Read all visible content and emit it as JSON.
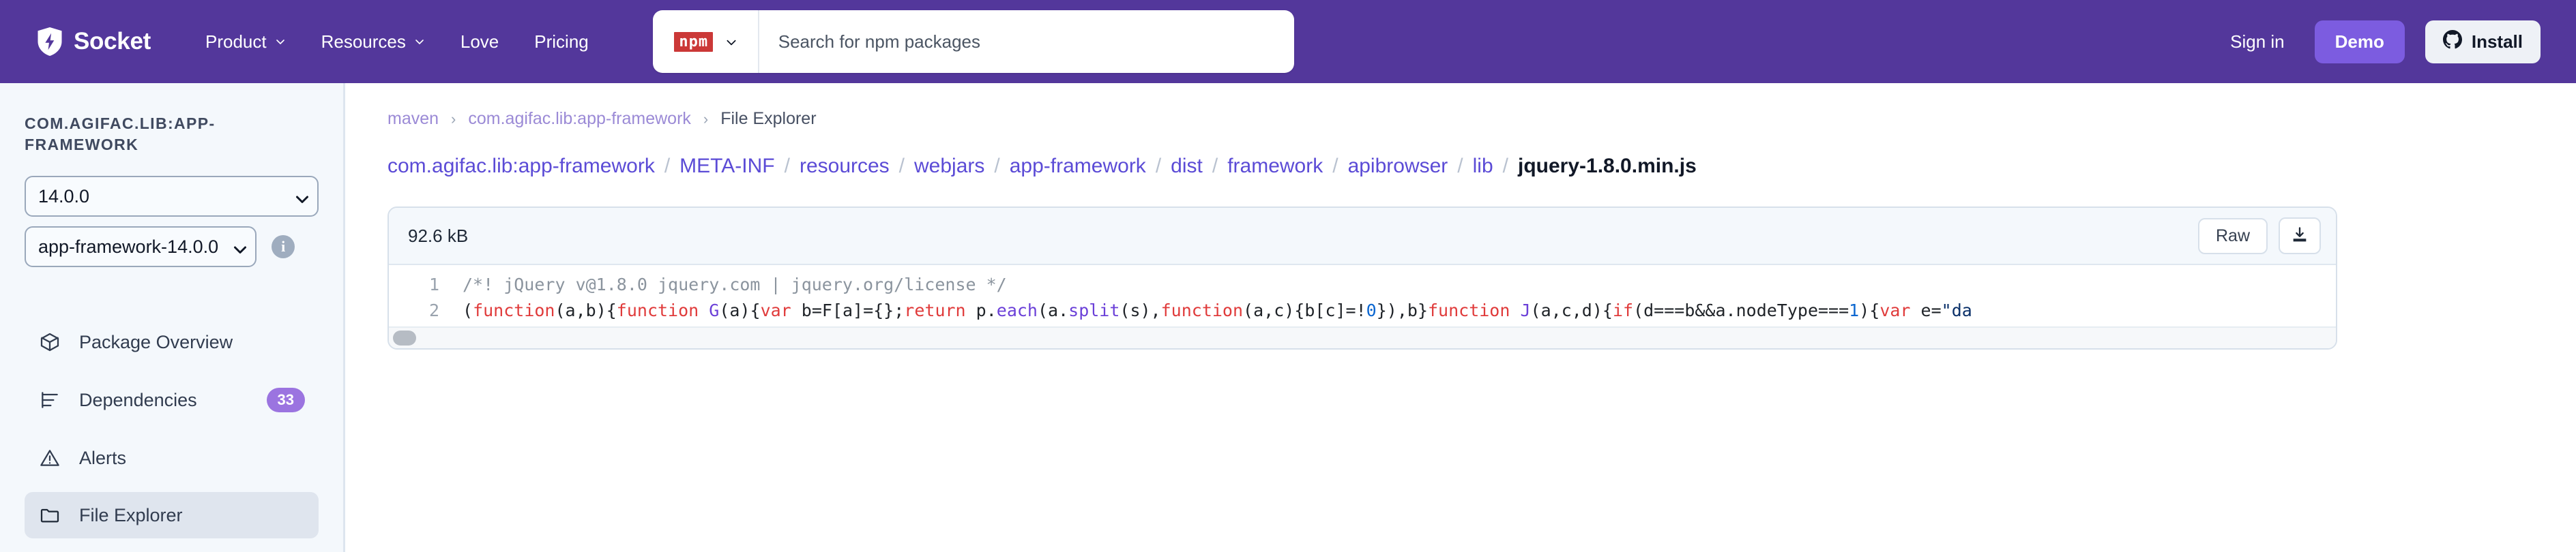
{
  "header": {
    "brand": "Socket",
    "nav": [
      {
        "label": "Product",
        "has_caret": true
      },
      {
        "label": "Resources",
        "has_caret": true
      },
      {
        "label": "Love",
        "has_caret": false
      },
      {
        "label": "Pricing",
        "has_caret": false
      }
    ],
    "search": {
      "ecosystem": "npm",
      "placeholder": "Search for npm packages",
      "value": ""
    },
    "sign_in": "Sign in",
    "demo": "Demo",
    "install": "Install",
    "bg_color": "#53379b",
    "demo_color": "#7c5ce0"
  },
  "sidebar": {
    "package_title": "com.agifac.lib:app-framework",
    "version_select": "14.0.0",
    "artifact_select": "app-framework-14.0.0",
    "items": [
      {
        "label": "Package Overview",
        "icon": "package-icon",
        "badge": null,
        "active": false
      },
      {
        "label": "Dependencies",
        "icon": "dependencies-icon",
        "badge": "33",
        "active": false
      },
      {
        "label": "Alerts",
        "icon": "alert-triangle-icon",
        "badge": null,
        "active": false
      },
      {
        "label": "File Explorer",
        "icon": "folder-icon",
        "badge": null,
        "active": true
      }
    ],
    "badge_color": "#9b74e0"
  },
  "breadcrumb": {
    "items": [
      "maven",
      "com.agifac.lib:app-framework",
      "File Explorer"
    ],
    "separator": "›"
  },
  "file_path": {
    "segments": [
      "com.agifac.lib:app-framework",
      "META-INF",
      "resources",
      "webjars",
      "app-framework",
      "dist",
      "framework",
      "apibrowser",
      "lib"
    ],
    "separator": "/",
    "file_name": "jquery-1.8.0.min.js"
  },
  "file_card": {
    "size": "92.6 kB",
    "raw_label": "Raw",
    "download_icon": "download-icon",
    "lines": [
      {
        "number": "1",
        "tokens": [
          {
            "t": "/*! jQuery v@1.8.0 jquery.com | jquery.org/license */",
            "c": "c-comment"
          }
        ]
      },
      {
        "number": "2",
        "tokens": [
          {
            "t": "(",
            "c": "c-plain"
          },
          {
            "t": "function",
            "c": "c-kw"
          },
          {
            "t": "(a,b){",
            "c": "c-plain"
          },
          {
            "t": "function",
            "c": "c-kw"
          },
          {
            "t": " ",
            "c": "c-plain"
          },
          {
            "t": "G",
            "c": "c-fn"
          },
          {
            "t": "(a){",
            "c": "c-plain"
          },
          {
            "t": "var",
            "c": "c-kw"
          },
          {
            "t": " b=F[a]={};",
            "c": "c-plain"
          },
          {
            "t": "return",
            "c": "c-kw"
          },
          {
            "t": " p.",
            "c": "c-plain"
          },
          {
            "t": "each",
            "c": "c-fn"
          },
          {
            "t": "(a.",
            "c": "c-plain"
          },
          {
            "t": "split",
            "c": "c-fn"
          },
          {
            "t": "(s),",
            "c": "c-plain"
          },
          {
            "t": "function",
            "c": "c-kw"
          },
          {
            "t": "(a,c){b[c]=!",
            "c": "c-plain"
          },
          {
            "t": "0",
            "c": "c-num"
          },
          {
            "t": "}),b}",
            "c": "c-plain"
          },
          {
            "t": "function",
            "c": "c-kw"
          },
          {
            "t": " ",
            "c": "c-plain"
          },
          {
            "t": "J",
            "c": "c-fn"
          },
          {
            "t": "(a,c,d){",
            "c": "c-plain"
          },
          {
            "t": "if",
            "c": "c-kw"
          },
          {
            "t": "(d===b&&a.nodeType===",
            "c": "c-plain"
          },
          {
            "t": "1",
            "c": "c-num"
          },
          {
            "t": "){",
            "c": "c-plain"
          },
          {
            "t": "var",
            "c": "c-kw"
          },
          {
            "t": " e=",
            "c": "c-plain"
          },
          {
            "t": "\"da",
            "c": "c-str"
          }
        ]
      }
    ]
  }
}
